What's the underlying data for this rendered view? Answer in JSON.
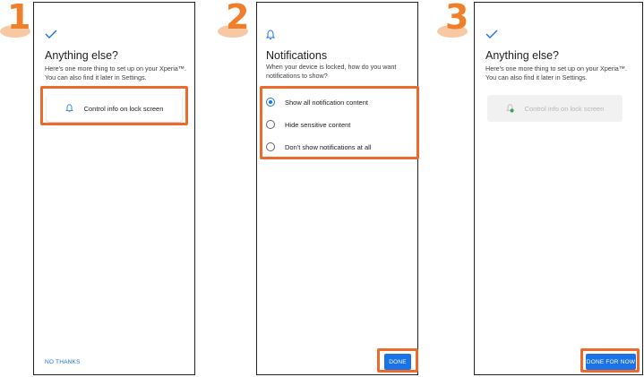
{
  "steps": [
    "1",
    "2",
    "3"
  ],
  "panel1": {
    "title": "Anything else?",
    "description": "Here's one more thing to set up on your Xperia™. You can also find it later in Settings.",
    "card_label": "Control info on lock screen",
    "no_thanks": "NO THANKS"
  },
  "panel2": {
    "title": "Notifications",
    "description": "When your device is locked, how do you want notifications to show?",
    "options": [
      {
        "label": "Show all notification content",
        "selected": true
      },
      {
        "label": "Hide sensitive content",
        "selected": false
      },
      {
        "label": "Don't show notifications at all",
        "selected": false
      }
    ],
    "done": "DONE"
  },
  "panel3": {
    "title": "Anything else?",
    "description": "Here's one more thing to set up on your Xperia™. You can also find it later in Settings.",
    "card_label": "Control info on lock screen",
    "done_for_now": "DONE FOR NOW"
  },
  "colors": {
    "accent": "#1a73e8",
    "highlight": "#ec6a2c",
    "step_number": "#f07f2b"
  },
  "icons": [
    "check-icon",
    "bell-icon",
    "bell-check-icon"
  ]
}
